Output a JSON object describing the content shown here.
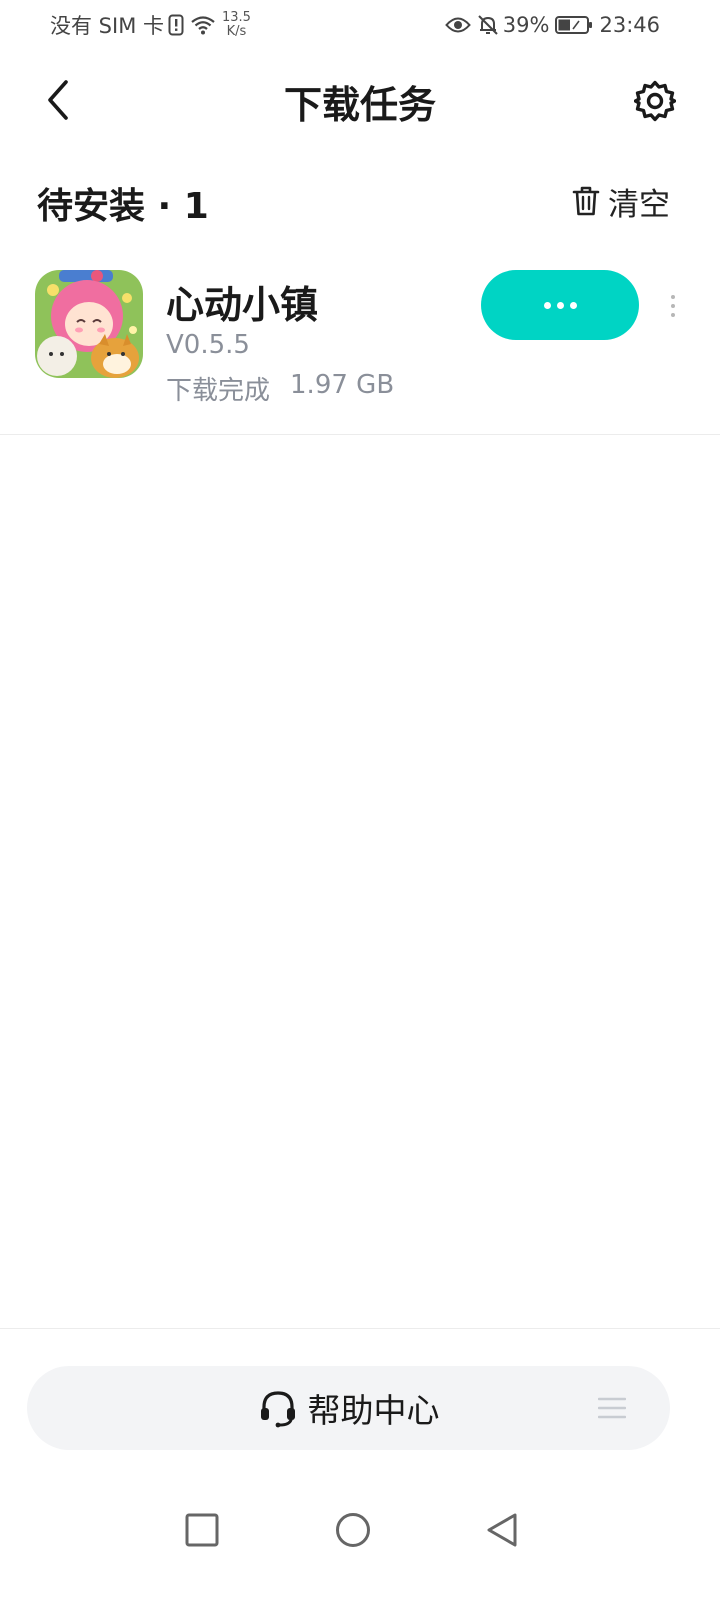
{
  "status_bar": {
    "carrier": "没有 SIM 卡",
    "speed_value": "13.5",
    "speed_unit": "K/s",
    "battery": "39%",
    "time": "23:46"
  },
  "header": {
    "title": "下载任务"
  },
  "section": {
    "title": "待安装 · 1",
    "clear_label": "清空"
  },
  "downloads": [
    {
      "name": "心动小镇",
      "version": "V0.5.5",
      "status": "下载完成",
      "size": "1.97 GB"
    }
  ],
  "help": {
    "label": "帮助中心"
  },
  "colors": {
    "accent": "#00d4c4",
    "secondary_text": "#8a8f99",
    "help_bar_bg": "#f3f4f6"
  },
  "icons": {
    "back": "chevron-left-icon",
    "settings": "gear-icon",
    "clear": "trash-icon",
    "help": "headset-icon",
    "nav_recent": "square-icon",
    "nav_home": "circle-icon",
    "nav_back": "triangle-back-icon"
  }
}
